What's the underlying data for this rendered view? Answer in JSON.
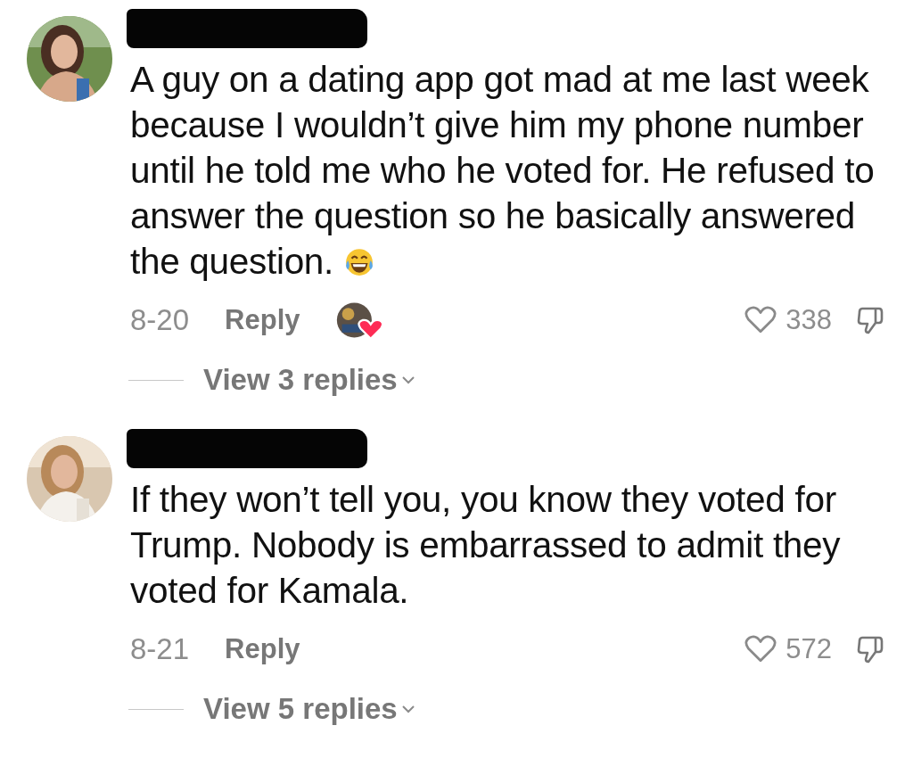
{
  "comments": [
    {
      "name_redacted": true,
      "text": "A guy on a dating app got mad at me last week because I wouldn’t give him my phone number until he told me who he voted for. He refused to answer the question so he basically answered the question.",
      "trailing_emoji": true,
      "date": "8-20",
      "reply_label": "Reply",
      "creator_liked": true,
      "likes": "338",
      "liked": false,
      "replies_label": "View 3 replies"
    },
    {
      "name_redacted": true,
      "text": "If they won’t tell you, you know they voted for Trump. Nobody is embarrassed to admit they voted for Kamala.",
      "date": "8-21",
      "reply_label": "Reply",
      "creator_liked": false,
      "likes": "572",
      "liked": false,
      "replies_label": "View 5 replies"
    }
  ]
}
